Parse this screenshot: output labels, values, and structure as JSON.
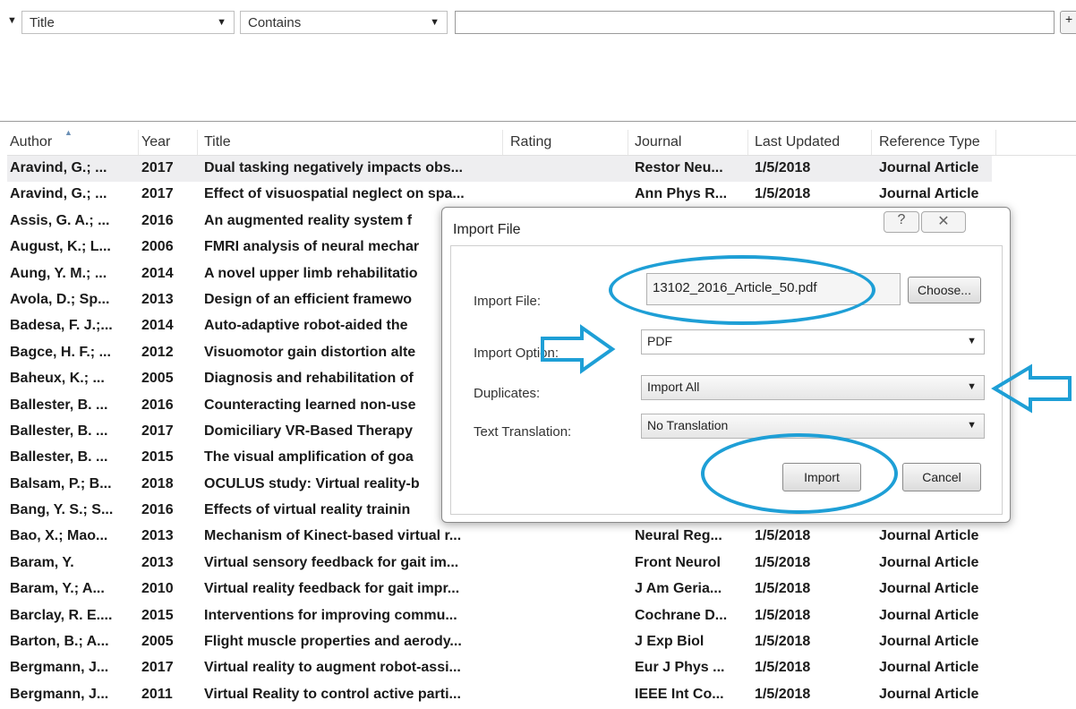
{
  "search": {
    "field_value": "Title",
    "operator_value": "Contains",
    "query_value": "",
    "plus_label": "+"
  },
  "table": {
    "columns": {
      "author": "Author",
      "year": "Year",
      "title": "Title",
      "rating": "Rating",
      "journal": "Journal",
      "updated": "Last Updated",
      "type": "Reference Type"
    },
    "rows": [
      {
        "author": "Aravind, G.; ...",
        "year": "2017",
        "title": "Dual tasking negatively impacts obs...",
        "journal": "Restor Neu...",
        "updated": "1/5/2018",
        "type": "Journal Article"
      },
      {
        "author": "Aravind, G.; ...",
        "year": "2017",
        "title": "Effect of visuospatial neglect on spa...",
        "journal": "Ann Phys R...",
        "updated": "1/5/2018",
        "type": "Journal Article"
      },
      {
        "author": "Assis, G. A.; ...",
        "year": "2016",
        "title": "An augmented reality system f",
        "journal": "",
        "updated": "",
        "type": ""
      },
      {
        "author": "August, K.; L...",
        "year": "2006",
        "title": "FMRI analysis of neural mechar",
        "journal": "",
        "updated": "",
        "type": ""
      },
      {
        "author": "Aung, Y. M.; ...",
        "year": "2014",
        "title": "A novel upper limb rehabilitatio",
        "journal": "",
        "updated": "",
        "type": ""
      },
      {
        "author": "Avola, D.; Sp...",
        "year": "2013",
        "title": "Design of an efficient framewo",
        "journal": "",
        "updated": "",
        "type": ""
      },
      {
        "author": "Badesa, F. J.;...",
        "year": "2014",
        "title": "Auto-adaptive robot-aided the",
        "journal": "",
        "updated": "",
        "type": ""
      },
      {
        "author": "Bagce, H. F.; ...",
        "year": "2012",
        "title": "Visuomotor gain distortion alte",
        "journal": "",
        "updated": "",
        "type": ""
      },
      {
        "author": "Baheux, K.; ...",
        "year": "2005",
        "title": "Diagnosis and rehabilitation of",
        "journal": "",
        "updated": "",
        "type": ""
      },
      {
        "author": "Ballester, B. ...",
        "year": "2016",
        "title": "Counteracting learned non-use",
        "journal": "",
        "updated": "",
        "type": ""
      },
      {
        "author": "Ballester, B. ...",
        "year": "2017",
        "title": "Domiciliary VR-Based Therapy",
        "journal": "",
        "updated": "",
        "type": ""
      },
      {
        "author": "Ballester, B. ...",
        "year": "2015",
        "title": "The visual amplification of goa",
        "journal": "",
        "updated": "",
        "type": ""
      },
      {
        "author": "Balsam, P.; B...",
        "year": "2018",
        "title": "OCULUS study: Virtual reality-b",
        "journal": "",
        "updated": "",
        "type": ""
      },
      {
        "author": "Bang, Y. S.; S...",
        "year": "2016",
        "title": "Effects of virtual reality trainin",
        "journal": "",
        "updated": "",
        "type": ""
      },
      {
        "author": "Bao, X.; Mao...",
        "year": "2013",
        "title": "Mechanism of Kinect-based virtual r...",
        "journal": "Neural Reg...",
        "updated": "1/5/2018",
        "type": "Journal Article"
      },
      {
        "author": "Baram, Y.",
        "year": "2013",
        "title": "Virtual sensory feedback for gait im...",
        "journal": "Front Neurol",
        "updated": "1/5/2018",
        "type": "Journal Article"
      },
      {
        "author": "Baram, Y.; A...",
        "year": "2010",
        "title": "Virtual reality feedback for gait impr...",
        "journal": "J Am Geria...",
        "updated": "1/5/2018",
        "type": "Journal Article"
      },
      {
        "author": "Barclay, R. E....",
        "year": "2015",
        "title": "Interventions for improving commu...",
        "journal": "Cochrane D...",
        "updated": "1/5/2018",
        "type": "Journal Article"
      },
      {
        "author": "Barton, B.; A...",
        "year": "2005",
        "title": "Flight muscle properties and aerody...",
        "journal": "J Exp Biol",
        "updated": "1/5/2018",
        "type": "Journal Article"
      },
      {
        "author": "Bergmann, J...",
        "year": "2017",
        "title": "Virtual reality to augment robot-assi...",
        "journal": "Eur J Phys ...",
        "updated": "1/5/2018",
        "type": "Journal Article"
      },
      {
        "author": "Bergmann, J...",
        "year": "2011",
        "title": "Virtual Reality to control active parti...",
        "journal": "IEEE Int Co...",
        "updated": "1/5/2018",
        "type": "Journal Article"
      }
    ]
  },
  "dialog": {
    "title": "Import File",
    "help_glyph": "?",
    "close_glyph": "✕",
    "import_file_label": "Import File:",
    "import_file_value": "13102_2016_Article_50.pdf",
    "choose_label": "Choose...",
    "import_option_label": "Import Option:",
    "import_option_value": "PDF",
    "duplicates_label": "Duplicates:",
    "duplicates_value": "Import All",
    "translation_label": "Text Translation:",
    "translation_value": "No Translation",
    "import_button": "Import",
    "cancel_button": "Cancel"
  },
  "colors": {
    "annotation": "#1e9fd6",
    "selected_row": "#eeeef0"
  },
  "icons": [
    "chevron-down-icon",
    "sort-ascending-icon",
    "help-icon",
    "close-icon",
    "arrow-right-icon",
    "arrow-left-icon"
  ]
}
